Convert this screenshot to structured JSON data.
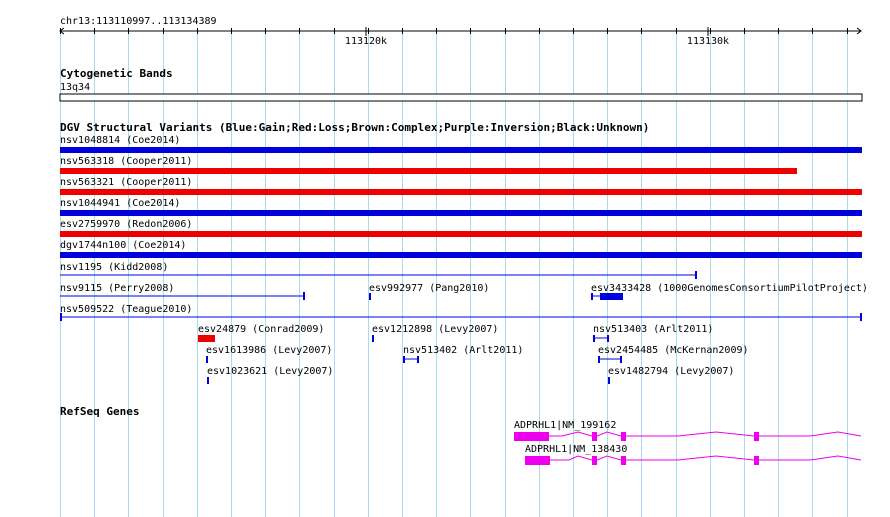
{
  "region_label": "chr13:113110997..113134389",
  "ruler": {
    "ticks": [
      {
        "label": "113120k",
        "pos": 113120000
      },
      {
        "label": "113130k",
        "pos": 113130000
      }
    ]
  },
  "cytoband": {
    "title": "Cytogenetic Bands",
    "band_label": "13q34"
  },
  "dgv": {
    "title": "DGV Structural Variants (Blue:Gain;Red:Loss;Brown:Complex;Purple:Inversion;Black:Unknown)",
    "colors": {
      "gain": "#0000dd",
      "loss": "#ee0000",
      "unknown": "#000000"
    }
  },
  "refseq": {
    "title": "RefSeq Genes",
    "color": "#ee00ee",
    "genes": [
      {
        "label": "ADPRHL1|NM_199162"
      },
      {
        "label": "ADPRHL1|NM_138430"
      }
    ]
  },
  "variants": [
    {
      "label": "nsv1048814 (Coe2014)",
      "type": "gain"
    },
    {
      "label": "nsv563318 (Cooper2011)",
      "type": "loss"
    },
    {
      "label": "nsv563321 (Cooper2011)",
      "type": "loss"
    },
    {
      "label": "nsv1044941 (Coe2014)",
      "type": "gain"
    },
    {
      "label": "esv2759970 (Redon2006)",
      "type": "loss"
    },
    {
      "label": "dgv1744n100 (Coe2014)",
      "type": "gain"
    },
    {
      "label": "nsv1195 (Kidd2008)",
      "type": "gain"
    },
    {
      "label": "nsv9115 (Perry2008)",
      "type": "gain"
    },
    {
      "label": "esv992977 (Pang2010)",
      "type": "gain"
    },
    {
      "label": "esv3433428 (1000GenomesConsortiumPilotProject)",
      "type": "gain"
    },
    {
      "label": "nsv509522 (Teague2010)",
      "type": "gain"
    },
    {
      "label": "esv24879 (Conrad2009)",
      "type": "loss"
    },
    {
      "label": "esv1212898 (Levy2007)",
      "type": "gain"
    },
    {
      "label": "nsv513403 (Arlt2011)",
      "type": "gain"
    },
    {
      "label": "esv1613986 (Levy2007)",
      "type": "gain"
    },
    {
      "label": "nsv513402 (Arlt2011)",
      "type": "gain"
    },
    {
      "label": "esv2454485 (McKernan2009)",
      "type": "gain"
    },
    {
      "label": "esv1023621 (Levy2007)",
      "type": "gain"
    },
    {
      "label": "esv1482794 (Levy2007)",
      "type": "gain"
    }
  ]
}
